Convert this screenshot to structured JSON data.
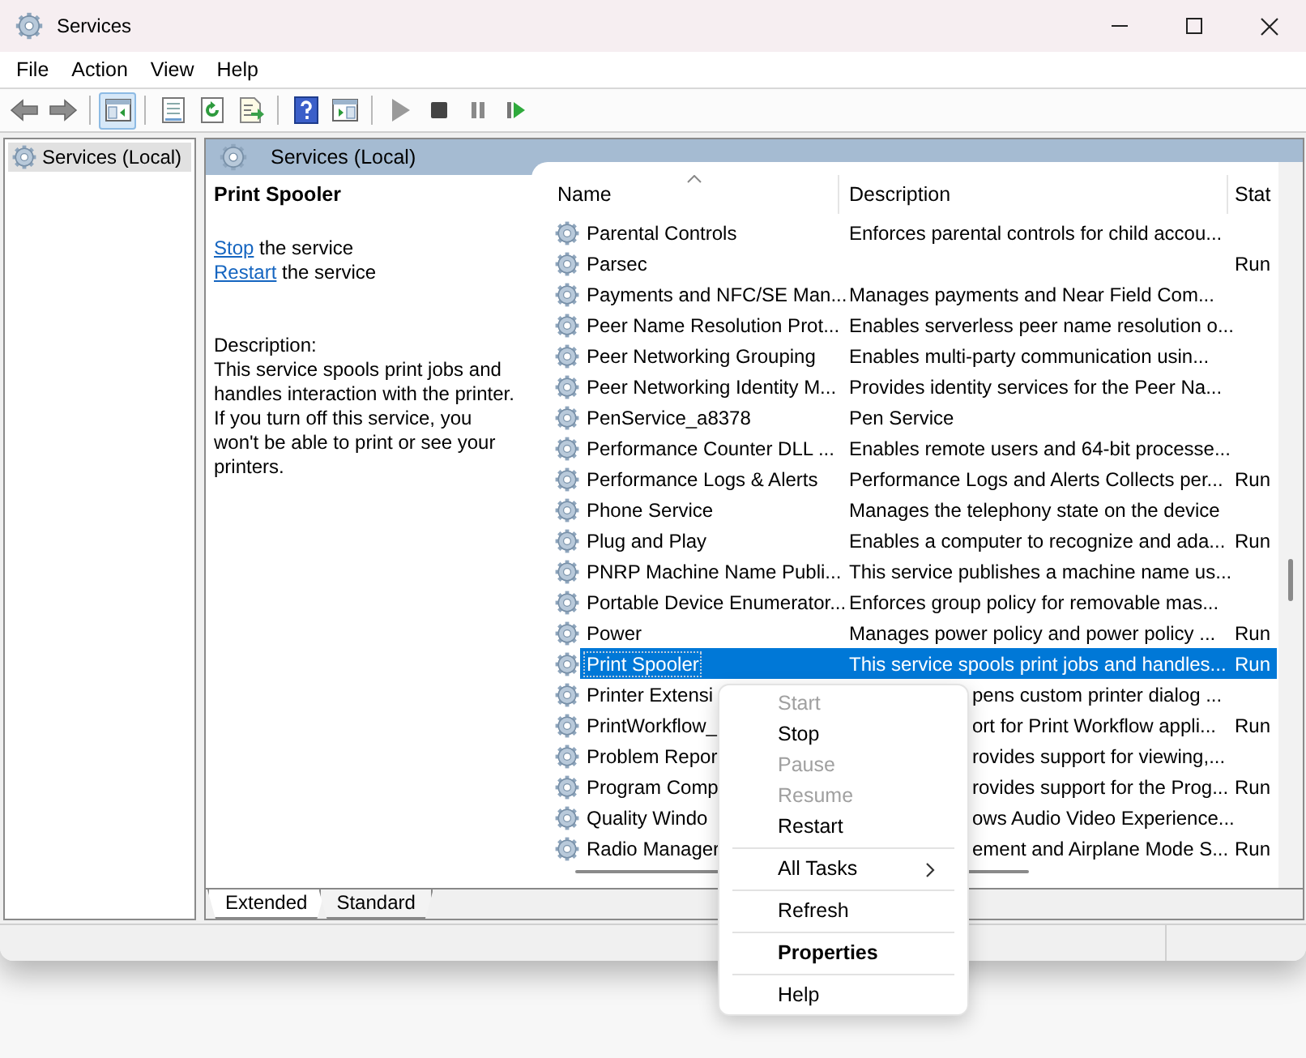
{
  "window": {
    "title": "Services"
  },
  "menu_bar": [
    "File",
    "Action",
    "View",
    "Help"
  ],
  "toolbar": [
    {
      "kind": "back",
      "pressed": false
    },
    {
      "kind": "forward",
      "pressed": false
    },
    {
      "kind": "separator"
    },
    {
      "kind": "console-tree",
      "pressed": true
    },
    {
      "kind": "separator"
    },
    {
      "kind": "properties",
      "pressed": false
    },
    {
      "kind": "refresh",
      "pressed": false
    },
    {
      "kind": "export",
      "pressed": false
    },
    {
      "kind": "separator"
    },
    {
      "kind": "help",
      "pressed": false
    },
    {
      "kind": "action-pane",
      "pressed": false
    },
    {
      "kind": "separator"
    },
    {
      "kind": "play",
      "pressed": false
    },
    {
      "kind": "stop",
      "pressed": false
    },
    {
      "kind": "pause",
      "pressed": false
    },
    {
      "kind": "resume",
      "pressed": false
    }
  ],
  "tree": {
    "items": [
      {
        "label": "Services (Local)",
        "selected": true
      }
    ]
  },
  "details_pane": {
    "header": "Services (Local)",
    "service_name": "Print Spooler",
    "actions": [
      {
        "link": "Stop",
        "text": "the service"
      },
      {
        "link": "Restart",
        "text": "the service"
      }
    ],
    "description_label": "Description:",
    "description": "This service spools print jobs and handles interaction with the printer. If you turn off this service, you won't be able to print or see your printers."
  },
  "table": {
    "columns": [
      {
        "label": "Name",
        "sorted": true
      },
      {
        "label": "Description",
        "sorted": false
      },
      {
        "label": "Stat",
        "sorted": false
      }
    ],
    "rows": [
      {
        "kind": "full",
        "name": "Parental Controls",
        "description": "Enforces parental controls for child accou...",
        "status": "",
        "selected": false
      },
      {
        "kind": "full",
        "name": "Parsec",
        "description": "",
        "status": "Run",
        "selected": false
      },
      {
        "kind": "full",
        "name": "Payments and NFC/SE Man...",
        "description": "Manages payments and Near Field Com...",
        "status": "",
        "selected": false
      },
      {
        "kind": "full",
        "name": "Peer Name Resolution Prot...",
        "description": "Enables serverless peer name resolution o...",
        "status": "",
        "selected": false
      },
      {
        "kind": "full",
        "name": "Peer Networking Grouping",
        "description": "Enables multi-party communication usin...",
        "status": "",
        "selected": false
      },
      {
        "kind": "full",
        "name": "Peer Networking Identity M...",
        "description": "Provides identity services for the Peer Na...",
        "status": "",
        "selected": false
      },
      {
        "kind": "full",
        "name": "PenService_a8378",
        "description": "Pen Service",
        "status": "",
        "selected": false
      },
      {
        "kind": "full",
        "name": "Performance Counter DLL ...",
        "description": "Enables remote users and 64-bit processe...",
        "status": "",
        "selected": false
      },
      {
        "kind": "full",
        "name": "Performance Logs & Alerts",
        "description": "Performance Logs and Alerts Collects per...",
        "status": "Run",
        "selected": false
      },
      {
        "kind": "full",
        "name": "Phone Service",
        "description": "Manages the telephony state on the device",
        "status": "",
        "selected": false
      },
      {
        "kind": "full",
        "name": "Plug and Play",
        "description": "Enables a computer to recognize and ada...",
        "status": "Run",
        "selected": false
      },
      {
        "kind": "full",
        "name": "PNRP Machine Name Publi...",
        "description": "This service publishes a machine name us...",
        "status": "",
        "selected": false
      },
      {
        "kind": "full",
        "name": "Portable Device Enumerator...",
        "description": "Enforces group policy for removable mas...",
        "status": "",
        "selected": false
      },
      {
        "kind": "full",
        "name": "Power",
        "description": "Manages power policy and power policy ...",
        "status": "Run",
        "selected": false
      },
      {
        "kind": "full",
        "name": "Print Spooler",
        "description": "This service spools print jobs and handles...",
        "status": "Run",
        "selected": true
      },
      {
        "kind": "covered",
        "name": "Printer Extensi",
        "description": "pens custom printer dialog ...",
        "status": "",
        "selected": false
      },
      {
        "kind": "covered",
        "name": "PrintWorkflow_",
        "description": "ort for Print Workflow appli...",
        "status": "Run",
        "selected": false
      },
      {
        "kind": "covered",
        "name": "Problem Repor",
        "description": "rovides support for viewing,...",
        "status": "",
        "selected": false
      },
      {
        "kind": "covered",
        "name": "Program Comp",
        "description": "rovides support for the Prog...",
        "status": "Run",
        "selected": false
      },
      {
        "kind": "covered",
        "name": "Quality Windo",
        "description": "ows Audio Video Experience...",
        "status": "",
        "selected": false
      },
      {
        "kind": "covered",
        "name": "Radio Manager",
        "description": "ement and Airplane Mode S...",
        "status": "Run",
        "selected": false
      }
    ]
  },
  "tabs": [
    {
      "label": "Extended",
      "selected": true
    },
    {
      "label": "Standard",
      "selected": false
    }
  ],
  "context_menu": [
    {
      "kind": "item",
      "label": "Start",
      "disabled": true,
      "default": false,
      "has_submenu": false
    },
    {
      "kind": "item",
      "label": "Stop",
      "disabled": false,
      "default": false,
      "has_submenu": false
    },
    {
      "kind": "item",
      "label": "Pause",
      "disabled": true,
      "default": false,
      "has_submenu": false
    },
    {
      "kind": "item",
      "label": "Resume",
      "disabled": true,
      "default": false,
      "has_submenu": false
    },
    {
      "kind": "item",
      "label": "Restart",
      "disabled": false,
      "default": false,
      "has_submenu": false
    },
    {
      "kind": "separator"
    },
    {
      "kind": "item",
      "label": "All Tasks",
      "disabled": false,
      "default": false,
      "has_submenu": true
    },
    {
      "kind": "separator"
    },
    {
      "kind": "item",
      "label": "Refresh",
      "disabled": false,
      "default": false,
      "has_submenu": false
    },
    {
      "kind": "separator"
    },
    {
      "kind": "item",
      "label": "Properties",
      "disabled": false,
      "default": true,
      "has_submenu": false
    },
    {
      "kind": "separator"
    },
    {
      "kind": "item",
      "label": "Help",
      "disabled": false,
      "default": false,
      "has_submenu": false
    }
  ]
}
